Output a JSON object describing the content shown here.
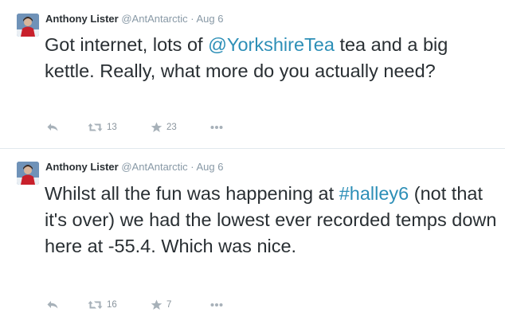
{
  "tweets": [
    {
      "fullname": "Anthony Lister",
      "username": "@AntAntarctic",
      "separator": "·",
      "time": "Aug 6",
      "text_before": "Got internet, lots of ",
      "link": "@YorkshireTea",
      "text_after": " tea and a big kettle. Really, what more do you actually need?",
      "retweets": "13",
      "favorites": "23"
    },
    {
      "fullname": "Anthony Lister",
      "username": "@AntAntarctic",
      "separator": "·",
      "time": "Aug 6",
      "text_before": "Whilst all the fun was happening at ",
      "link": "#halley6",
      "text_after": " (not that it's over) we had the lowest ever recorded temps down here at -55.4. Which was nice.",
      "retweets": "16",
      "favorites": "7"
    }
  ],
  "icons": {
    "reply": "reply-arrow-icon",
    "retweet": "retweet-icon",
    "favorite": "star-icon",
    "more": "more-dots-icon"
  },
  "colors": {
    "link": "#2d8fb7",
    "text": "#292f33",
    "muted": "#8899a6",
    "action": "#9aa5ae"
  }
}
